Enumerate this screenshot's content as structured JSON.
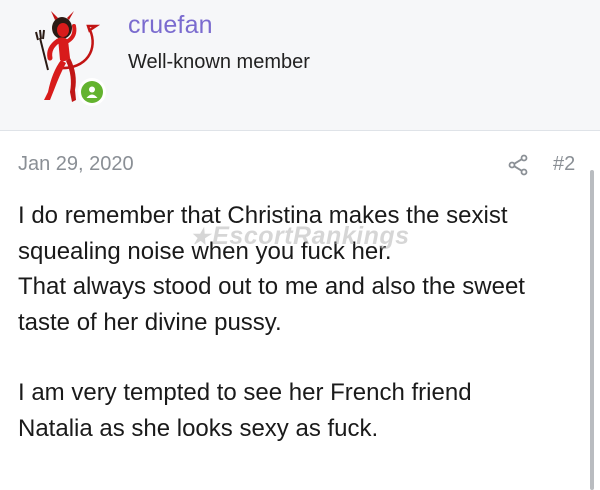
{
  "post": {
    "author": {
      "username": "cruefan",
      "title": "Well-known member",
      "avatar_icon": "devil-girl-avatar",
      "status_icon": "online-person-icon",
      "status_color": "#63b32f"
    },
    "date": "Jan 29, 2020",
    "number": "#2",
    "share_icon": "share-icon",
    "paragraphs": [
      {
        "lines": [
          "I do remember that Christina makes the sexist",
          "squealing noise when you fuck her.",
          "That always stood out to me and also the sweet",
          "taste of her divine pussy."
        ]
      },
      {
        "lines": [
          "I am very tempted to see her French friend",
          "Natalia as she looks sexy as fuck."
        ]
      }
    ]
  },
  "watermark": {
    "text": "EscortRankings"
  },
  "colors": {
    "username": "#7a6bcf",
    "header_bg": "#f6f7f9",
    "meta_text": "#8a8f95"
  }
}
